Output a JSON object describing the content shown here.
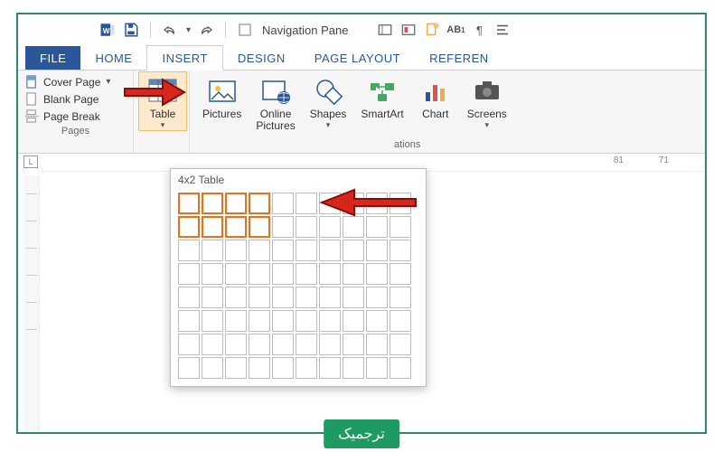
{
  "qat": {
    "nav_pane": "Navigation Pane"
  },
  "tabs": {
    "file": "FILE",
    "home": "HOME",
    "insert": "INSERT",
    "design": "DESIGN",
    "page_layout": "PAGE LAYOUT",
    "references": "REFEREN"
  },
  "ribbon": {
    "pages": {
      "cover_page": "Cover Page",
      "blank_page": "Blank Page",
      "page_break": "Page Break",
      "group_label": "Pages"
    },
    "table": {
      "label": "Table"
    },
    "illustrations": {
      "pictures": "Pictures",
      "online_pictures_l1": "Online",
      "online_pictures_l2": "Pictures",
      "shapes": "Shapes",
      "smartart": "SmartArt",
      "chart": "Chart",
      "screenshot": "Screens",
      "group_label": "ations"
    }
  },
  "popup": {
    "title": "4x2 Table",
    "cols": 10,
    "rows": 8,
    "sel_cols": 4,
    "sel_rows": 2
  },
  "ruler": {
    "r1": "81",
    "r2": "71"
  },
  "badge": "ترجمیک",
  "colors": {
    "accent": "#2a579a",
    "highlight": "#e8711a",
    "frame": "#2a8a6a",
    "badge": "#1e9b63"
  }
}
